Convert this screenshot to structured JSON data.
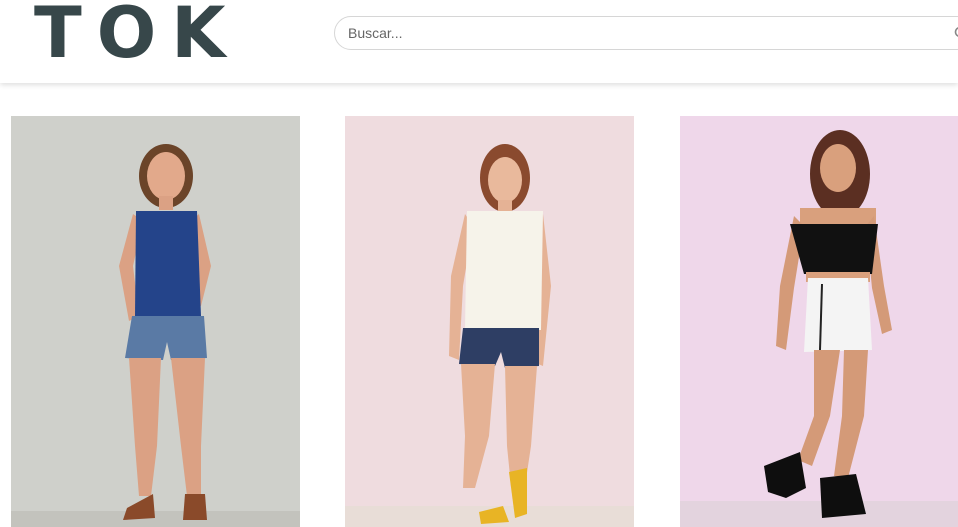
{
  "header": {
    "logo_text": "TOK",
    "search_placeholder": "Buscar..."
  },
  "products": [
    {
      "photo": "model-blue-tank-denim-shorts",
      "background": "#cfd0cb"
    },
    {
      "photo": "model-white-tank-denim-shorts",
      "background": "#efdcdf"
    },
    {
      "photo": "model-black-top-white-skirt",
      "background": "#efd7ea"
    }
  ],
  "colors": {
    "logo": "#37474a",
    "search_border": "#d6d6d6"
  }
}
